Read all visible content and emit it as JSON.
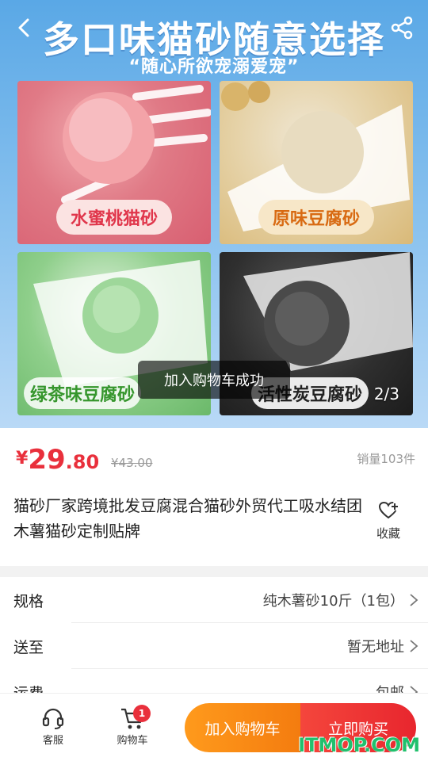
{
  "hero": {
    "title": "多口味猫砂随意选择",
    "subtitle": "“随心所欲宠溺爱宠”",
    "tiles": [
      {
        "label": "水蜜桃猫砂"
      },
      {
        "label": "原味豆腐砂"
      },
      {
        "label": "绿茶味豆腐砂"
      },
      {
        "label": "活性炭豆腐砂"
      }
    ],
    "pager": "2/3"
  },
  "toast": "加入购物车成功",
  "price": {
    "currency": "¥",
    "integer": "29",
    "decimal": ".80",
    "original": "¥43.00",
    "sales": "销量103件"
  },
  "product": {
    "title": "猫砂厂家跨境批发豆腐混合猫砂外贸代工吸水结团木薯猫砂定制贴牌",
    "favorite_label": "收藏"
  },
  "rows": [
    {
      "label": "规格",
      "value": "纯木薯砂10斤（1包）"
    },
    {
      "label": "送至",
      "value": "暂无地址"
    },
    {
      "label": "运费",
      "value": "包邮"
    }
  ],
  "bottom_bar": {
    "service_label": "客服",
    "cart_label": "购物车",
    "cart_count": "1",
    "add_to_cart": "加入购物车",
    "buy_now": "立即购买"
  },
  "watermark": "ITMOP.COM",
  "colors": {
    "accent_red": "#e9303c",
    "accent_orange": "#f47c0f",
    "hero_blue": "#5aa8e6"
  }
}
